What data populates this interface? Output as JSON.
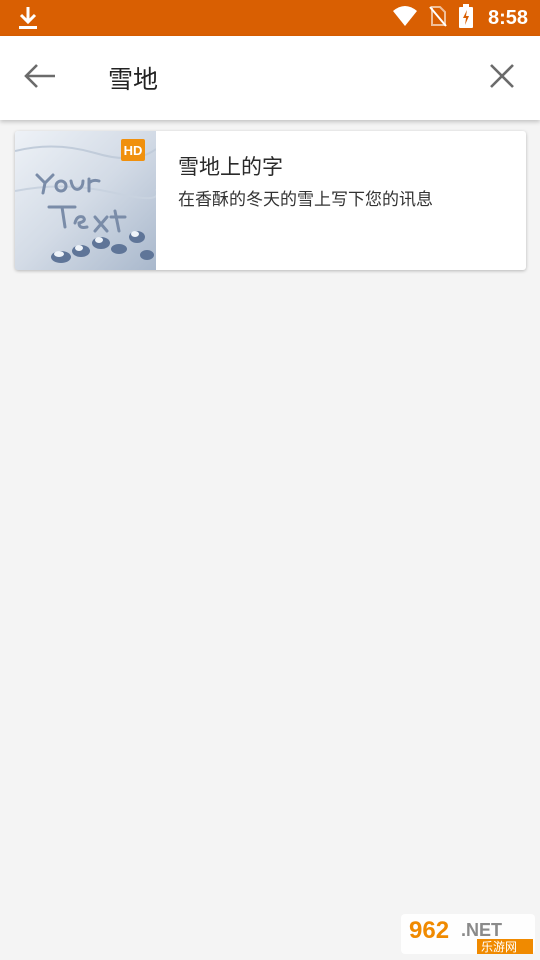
{
  "status_bar": {
    "time": "8:58",
    "background_color": "#d95f02",
    "icons": [
      "download-icon",
      "wifi-icon",
      "no-sim-icon",
      "battery-charging-icon"
    ]
  },
  "search": {
    "query": "雪地",
    "back_icon": "arrow-left-icon",
    "clear_icon": "close-icon"
  },
  "results": [
    {
      "title": "雪地上的字",
      "description": "在香酥的冬天的雪上写下您的讯息",
      "badge": "HD",
      "thumbnail_text": "Your Text"
    }
  ],
  "watermark": {
    "brand": "962.NET",
    "subtitle": "乐游网"
  }
}
